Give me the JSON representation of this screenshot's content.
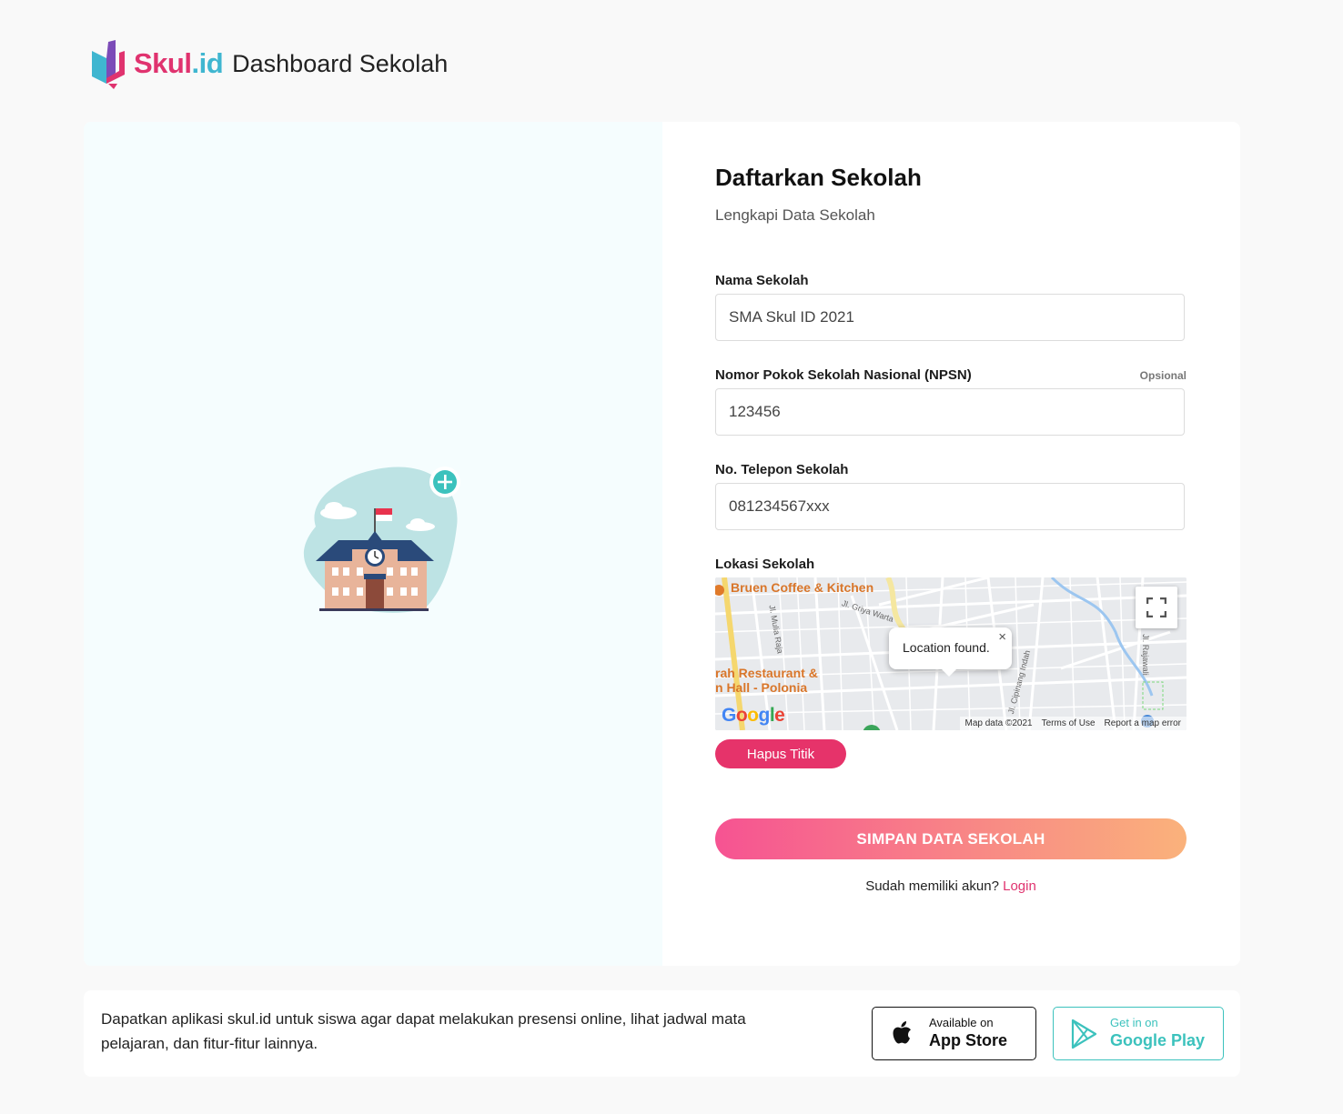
{
  "header": {
    "logo_text_part1": "Skul",
    "logo_text_part2": ".id",
    "title": "Dashboard Sekolah"
  },
  "form": {
    "title": "Daftarkan Sekolah",
    "subtitle": "Lengkapi Data Sekolah",
    "fields": {
      "nama": {
        "label": "Nama Sekolah",
        "value": "SMA Skul ID 2021"
      },
      "npsn": {
        "label": "Nomor Pokok Sekolah Nasional (NPSN)",
        "optional": "Opsional",
        "value": "123456"
      },
      "telepon": {
        "label": "No. Telepon Sekolah",
        "value": "081234567xxx"
      },
      "lokasi": {
        "label": "Lokasi Sekolah"
      }
    },
    "map": {
      "place_1": "Bruen Coffee & Kitchen",
      "place_2_line1": "rah Restaurant &",
      "place_2_line2": "n Hall - Polonia",
      "street_1": "Jl. Mulia Raja",
      "street_2": "Jl. Griya Warta",
      "street_3": "Jl. Cipinang Indah",
      "street_4": "Jl. Rajawali",
      "popup_text": "Location found.",
      "popup_close": "×",
      "google": "Google",
      "footer_data": "Map data ©2021",
      "footer_terms": "Terms of Use",
      "footer_report": "Report a map error"
    },
    "hapus_label": "Hapus Titik",
    "submit_label": "SIMPAN DATA SEKOLAH",
    "login_prompt": "Sudah memiliki akun?",
    "login_link": "Login"
  },
  "footer": {
    "text": "Dapatkan aplikasi skul.id untuk siswa agar dapat melakukan presensi online, lihat jadwal mata pelajaran, dan fitur-fitur lainnya.",
    "app_store": {
      "small": "Available on",
      "big": "App Store",
      "icon": "apple-icon"
    },
    "google_play": {
      "small": "Get in on",
      "big": "Google Play",
      "icon": "play-store-icon"
    }
  },
  "colors": {
    "brand_pink": "#e0336f",
    "brand_cyan": "#3fb6d0",
    "teal": "#3cc2bd",
    "gradient_start": "#f65392",
    "gradient_end": "#fab27b"
  }
}
